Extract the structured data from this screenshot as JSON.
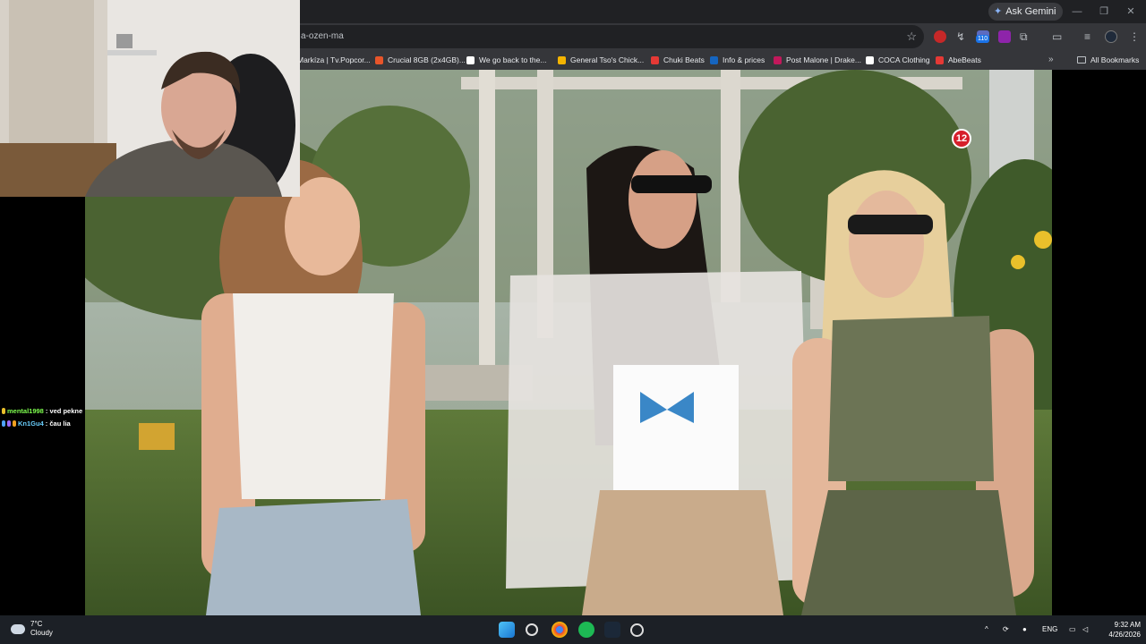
{
  "browser": {
    "ask_gemini": "Ask Gemini",
    "url": "a-ozen-ma",
    "badge_count": "110",
    "bookmarks": [
      {
        "label": "Markíza | Tv.Popcor...",
        "color": "#ffffff"
      },
      {
        "label": "Crucial 8GB (2x4GB)...",
        "color": "#e8552a"
      },
      {
        "label": "We go back to the...",
        "color": "#ffffff"
      },
      {
        "label": "General Tso's Chick...",
        "color": "#f4b400"
      },
      {
        "label": "Chuki Beats",
        "color": "#e53935"
      },
      {
        "label": "Info & prices",
        "color": "#1565c0"
      },
      {
        "label": "Post Malone | Drake...",
        "color": "#c2185b"
      },
      {
        "label": "COCA Clothing",
        "color": "#ffffff"
      },
      {
        "label": "AbeBeats",
        "color": "#e53935"
      }
    ],
    "all_bookmarks": "All Bookmarks"
  },
  "video": {
    "channel_logo": "12"
  },
  "chat": {
    "messages": [
      {
        "user": "mental1998",
        "text": ": ved pekne"
      },
      {
        "user": "Kn1Gu4",
        "text": ": čau lia"
      }
    ]
  },
  "taskbar": {
    "weather_temp": "7°C",
    "weather_desc": "Cloudy",
    "language": "ENG",
    "time": "9:32 AM",
    "date": "4/26/2026"
  }
}
